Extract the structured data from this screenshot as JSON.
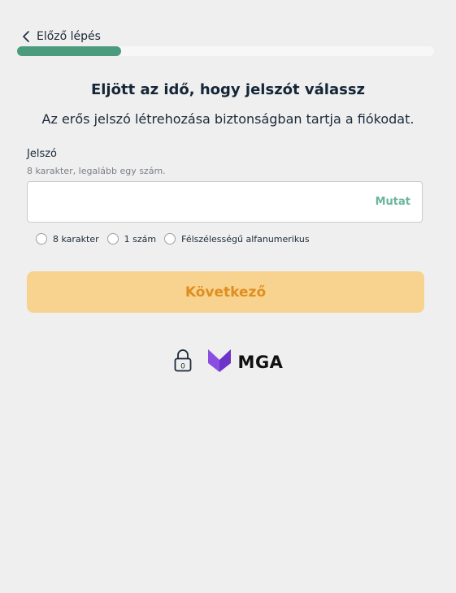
{
  "nav": {
    "back_label": "Előző lépés",
    "progress_fraction": 0.25,
    "progress_color": "#4b9b7f"
  },
  "content": {
    "title": "Eljött az idő, hogy jelszót válassz",
    "subtitle": "Az erős jelszó létrehozása biztonságban tartja a fiókodat."
  },
  "password_field": {
    "label": "Jelszó",
    "hint": "8 karakter, legalább egy szám.",
    "value": "",
    "placeholder": "",
    "show_label": "Mutat"
  },
  "requirements": [
    {
      "label": "8 karakter",
      "checked": false
    },
    {
      "label": "1 szám",
      "checked": false
    },
    {
      "label": "Félszélességű alfanumerikus",
      "checked": false
    }
  ],
  "next_button": {
    "label": "Következő",
    "color": "#f7d38f",
    "text_color": "#e08e1e"
  },
  "footer": {
    "lock_icon": "lock-18-icon",
    "lock_badge": "0",
    "brand_name": "MGA",
    "brand_color": "#8a4fe0"
  }
}
